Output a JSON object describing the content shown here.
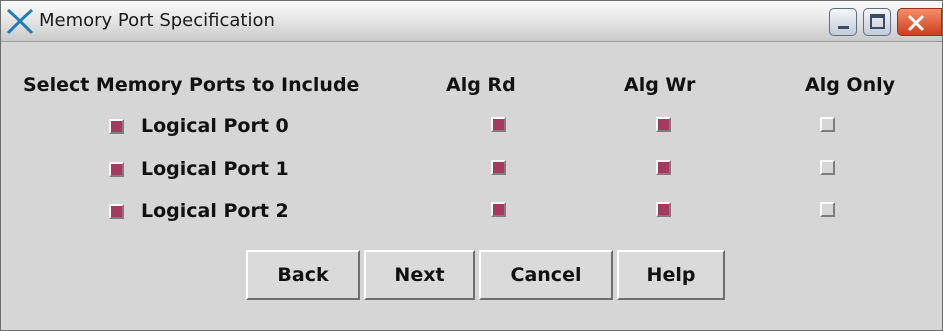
{
  "window": {
    "title": "Memory Port Specification",
    "icon": "x-cross-icon",
    "controls": [
      "minimize-icon",
      "maximize-icon",
      "close-icon"
    ]
  },
  "columns": {
    "select_label": "Select Memory Ports to Include",
    "alg_rd": "Alg Rd",
    "alg_wr": "Alg Wr",
    "alg_only": "Alg Only"
  },
  "ports": [
    {
      "label": "Logical Port 0",
      "include": true,
      "alg_rd": true,
      "alg_wr": true,
      "alg_only": false
    },
    {
      "label": "Logical Port 1",
      "include": true,
      "alg_rd": true,
      "alg_wr": true,
      "alg_only": false
    },
    {
      "label": "Logical Port 2",
      "include": true,
      "alg_rd": true,
      "alg_wr": true,
      "alg_only": false
    }
  ],
  "buttons": {
    "back": "Back",
    "next": "Next",
    "cancel": "Cancel",
    "help": "Help"
  },
  "colors": {
    "checked": "#a8385f",
    "unchecked": "#d6d6d6",
    "panel": "#d6d6d6"
  }
}
